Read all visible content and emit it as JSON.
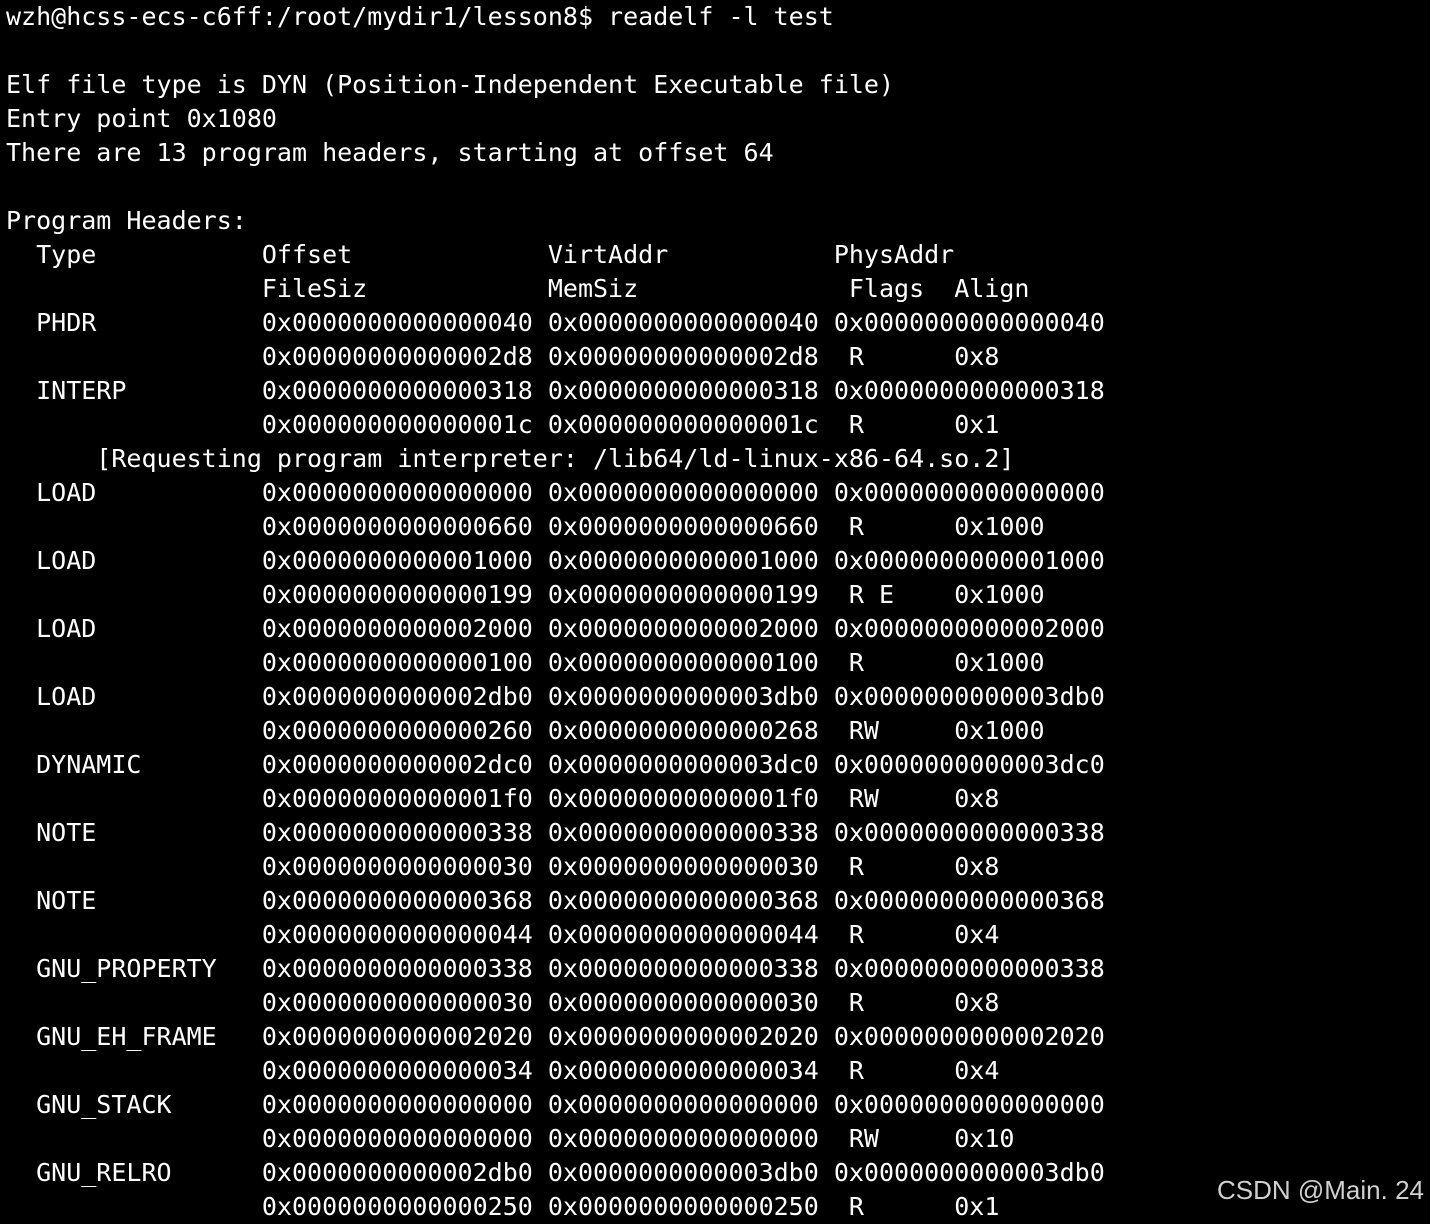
{
  "terminal": {
    "lines": [
      "wzh@hcss-ecs-c6ff:/root/mydir1/lesson8$ readelf -l test",
      "",
      "Elf file type is DYN (Position-Independent Executable file)",
      "Entry point 0x1080",
      "There are 13 program headers, starting at offset 64",
      "",
      "Program Headers:",
      "  Type           Offset             VirtAddr           PhysAddr",
      "                 FileSiz            MemSiz              Flags  Align",
      "  PHDR           0x0000000000000040 0x0000000000000040 0x0000000000000040",
      "                 0x00000000000002d8 0x00000000000002d8  R      0x8",
      "  INTERP         0x0000000000000318 0x0000000000000318 0x0000000000000318",
      "                 0x000000000000001c 0x000000000000001c  R      0x1",
      "      [Requesting program interpreter: /lib64/ld-linux-x86-64.so.2]",
      "  LOAD           0x0000000000000000 0x0000000000000000 0x0000000000000000",
      "                 0x0000000000000660 0x0000000000000660  R      0x1000",
      "  LOAD           0x0000000000001000 0x0000000000001000 0x0000000000001000",
      "                 0x0000000000000199 0x0000000000000199  R E    0x1000",
      "  LOAD           0x0000000000002000 0x0000000000002000 0x0000000000002000",
      "                 0x0000000000000100 0x0000000000000100  R      0x1000",
      "  LOAD           0x0000000000002db0 0x0000000000003db0 0x0000000000003db0",
      "                 0x0000000000000260 0x0000000000000268  RW     0x1000",
      "  DYNAMIC        0x0000000000002dc0 0x0000000000003dc0 0x0000000000003dc0",
      "                 0x00000000000001f0 0x00000000000001f0  RW     0x8",
      "  NOTE           0x0000000000000338 0x0000000000000338 0x0000000000000338",
      "                 0x0000000000000030 0x0000000000000030  R      0x8",
      "  NOTE           0x0000000000000368 0x0000000000000368 0x0000000000000368",
      "                 0x0000000000000044 0x0000000000000044  R      0x4",
      "  GNU_PROPERTY   0x0000000000000338 0x0000000000000338 0x0000000000000338",
      "                 0x0000000000000030 0x0000000000000030  R      0x8",
      "  GNU_EH_FRAME   0x0000000000002020 0x0000000000002020 0x0000000000002020",
      "                 0x0000000000000034 0x0000000000000034  R      0x4",
      "  GNU_STACK      0x0000000000000000 0x0000000000000000 0x0000000000000000",
      "                 0x0000000000000000 0x0000000000000000  RW     0x10",
      "  GNU_RELRO      0x0000000000002db0 0x0000000000003db0 0x0000000000003db0",
      "                 0x0000000000000250 0x0000000000000250  R      0x1"
    ],
    "background_color": "#000000",
    "text_color": "#ffffff"
  },
  "watermark": {
    "text": "CSDN @Main. 24"
  }
}
